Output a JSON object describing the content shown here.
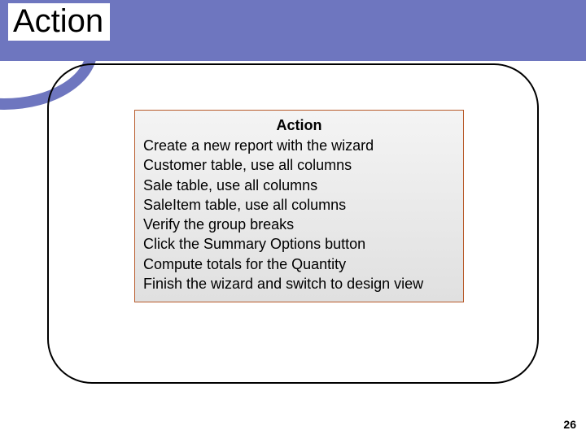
{
  "title": "Action",
  "box": {
    "heading": "Action",
    "lines": [
      "Create a new report with the wizard",
      "Customer table, use all columns",
      "Sale table, use all columns",
      "SaleItem table, use all columns",
      "Verify the group breaks",
      "Click the Summary Options button",
      "Compute totals for the Quantity",
      "Finish the wizard and switch to design view"
    ]
  },
  "page_number": "26"
}
